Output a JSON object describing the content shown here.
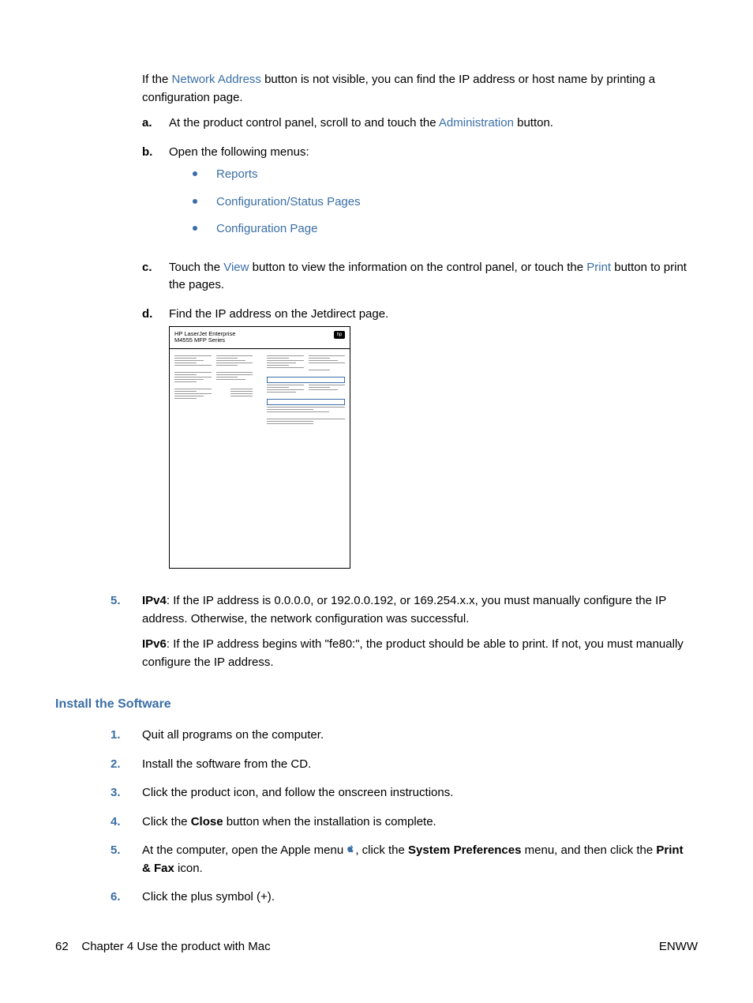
{
  "intro": {
    "prefix": "If the ",
    "link": "Network Address",
    "suffix": " button is not visible, you can find the IP address or host name by printing a configuration page."
  },
  "alpha": {
    "a": {
      "marker": "a.",
      "prefix": "At the product control panel, scroll to and touch the ",
      "link": "Administration",
      "suffix": " button."
    },
    "b": {
      "marker": "b.",
      "text": "Open the following menus:"
    },
    "bullets": {
      "b1": "Reports",
      "b2": "Configuration/Status Pages",
      "b3": "Configuration Page"
    },
    "c": {
      "marker": "c.",
      "p1": "Touch the ",
      "link1": "View",
      "p2": " button to view the information on the control panel, or touch the ",
      "link2": "Print",
      "p3": " button to print the pages."
    },
    "d": {
      "marker": "d.",
      "text": "Find the IP address on the Jetdirect page."
    }
  },
  "diagram": {
    "title1": "HP LaserJet Enterprise",
    "title2": "M4555 MFP Series"
  },
  "num5": {
    "marker": "5.",
    "ipv4_label": "IPv4",
    "ipv4_text": ": If the IP address is 0.0.0.0, or 192.0.0.192, or 169.254.x.x, you must manually configure the IP address. Otherwise, the network configuration was successful.",
    "ipv6_label": "IPv6",
    "ipv6_text": ": If the IP address begins with \"fe80:\", the product should be able to print. If not, you must manually configure the IP address."
  },
  "heading": "Install the Software",
  "install": {
    "i1": {
      "marker": "1.",
      "text": "Quit all programs on the computer."
    },
    "i2": {
      "marker": "2.",
      "text": "Install the software from the CD."
    },
    "i3": {
      "marker": "3.",
      "text": "Click the product icon, and follow the onscreen instructions."
    },
    "i4": {
      "marker": "4.",
      "p1": "Click the ",
      "bold": "Close",
      "p2": " button when the installation is complete."
    },
    "i5": {
      "marker": "5.",
      "p1": "At the computer, open the Apple menu ",
      "p2": ", click the ",
      "b1": "System Preferences",
      "p3": " menu, and then click the ",
      "b2": "Print & Fax",
      "p4": " icon."
    },
    "i6": {
      "marker": "6.",
      "text": "Click the plus symbol (+)."
    }
  },
  "footer": {
    "page": "62",
    "chapter": "Chapter 4   Use the product with Mac",
    "right": "ENWW"
  }
}
